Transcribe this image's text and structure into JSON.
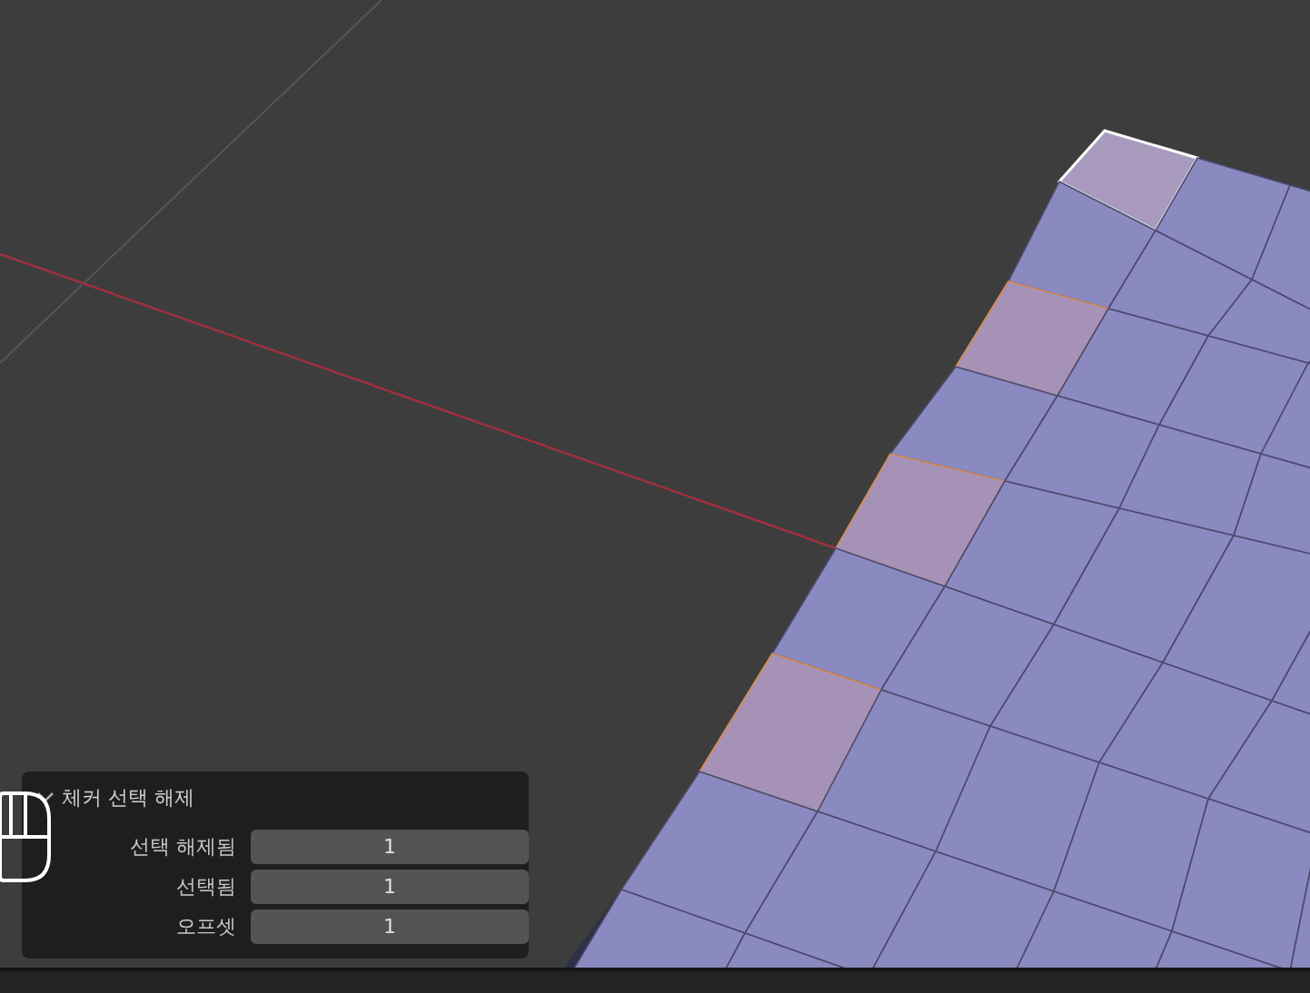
{
  "operator_panel": {
    "title": "체커 선택 해제",
    "expanded": true,
    "fields": [
      {
        "label": "선택 해제됨",
        "value": "1"
      },
      {
        "label": "선택됨",
        "value": "1"
      },
      {
        "label": "오프셋",
        "value": "1"
      }
    ]
  }
}
